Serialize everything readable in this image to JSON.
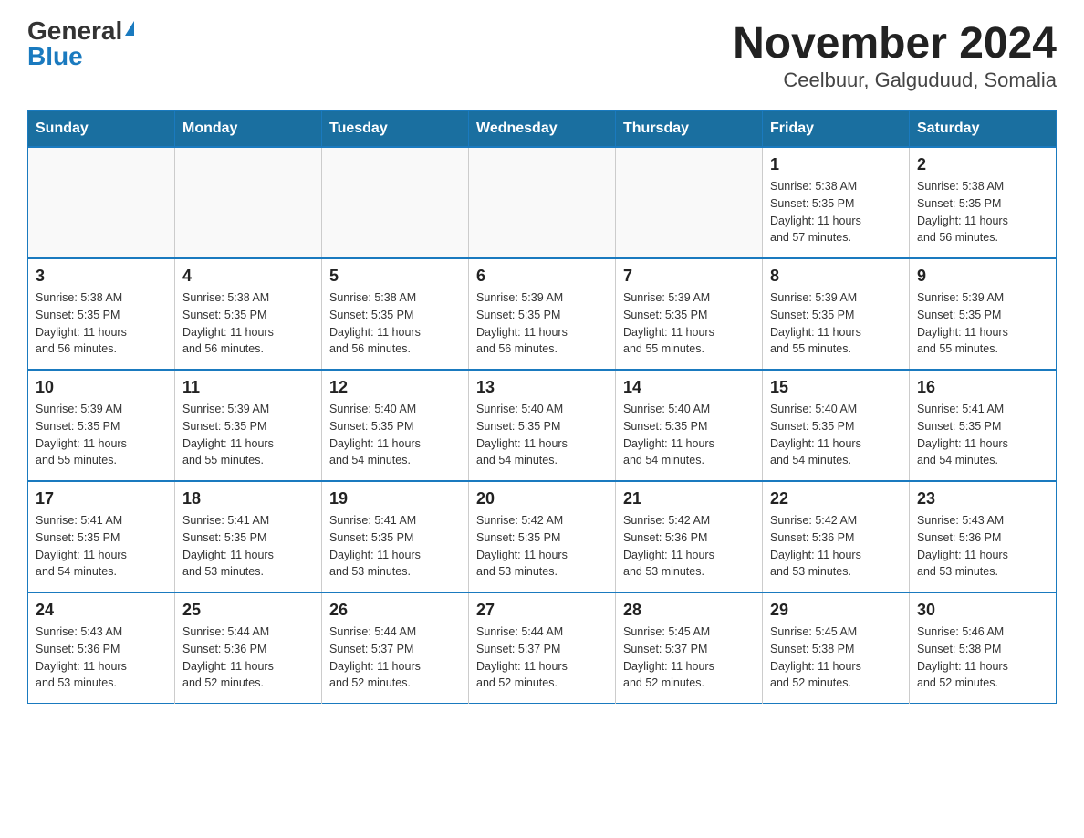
{
  "logo": {
    "general": "General",
    "blue": "Blue"
  },
  "title": "November 2024",
  "subtitle": "Ceelbuur, Galguduud, Somalia",
  "days_of_week": [
    "Sunday",
    "Monday",
    "Tuesday",
    "Wednesday",
    "Thursday",
    "Friday",
    "Saturday"
  ],
  "weeks": [
    [
      {
        "day": "",
        "info": ""
      },
      {
        "day": "",
        "info": ""
      },
      {
        "day": "",
        "info": ""
      },
      {
        "day": "",
        "info": ""
      },
      {
        "day": "",
        "info": ""
      },
      {
        "day": "1",
        "info": "Sunrise: 5:38 AM\nSunset: 5:35 PM\nDaylight: 11 hours\nand 57 minutes."
      },
      {
        "day": "2",
        "info": "Sunrise: 5:38 AM\nSunset: 5:35 PM\nDaylight: 11 hours\nand 56 minutes."
      }
    ],
    [
      {
        "day": "3",
        "info": "Sunrise: 5:38 AM\nSunset: 5:35 PM\nDaylight: 11 hours\nand 56 minutes."
      },
      {
        "day": "4",
        "info": "Sunrise: 5:38 AM\nSunset: 5:35 PM\nDaylight: 11 hours\nand 56 minutes."
      },
      {
        "day": "5",
        "info": "Sunrise: 5:38 AM\nSunset: 5:35 PM\nDaylight: 11 hours\nand 56 minutes."
      },
      {
        "day": "6",
        "info": "Sunrise: 5:39 AM\nSunset: 5:35 PM\nDaylight: 11 hours\nand 56 minutes."
      },
      {
        "day": "7",
        "info": "Sunrise: 5:39 AM\nSunset: 5:35 PM\nDaylight: 11 hours\nand 55 minutes."
      },
      {
        "day": "8",
        "info": "Sunrise: 5:39 AM\nSunset: 5:35 PM\nDaylight: 11 hours\nand 55 minutes."
      },
      {
        "day": "9",
        "info": "Sunrise: 5:39 AM\nSunset: 5:35 PM\nDaylight: 11 hours\nand 55 minutes."
      }
    ],
    [
      {
        "day": "10",
        "info": "Sunrise: 5:39 AM\nSunset: 5:35 PM\nDaylight: 11 hours\nand 55 minutes."
      },
      {
        "day": "11",
        "info": "Sunrise: 5:39 AM\nSunset: 5:35 PM\nDaylight: 11 hours\nand 55 minutes."
      },
      {
        "day": "12",
        "info": "Sunrise: 5:40 AM\nSunset: 5:35 PM\nDaylight: 11 hours\nand 54 minutes."
      },
      {
        "day": "13",
        "info": "Sunrise: 5:40 AM\nSunset: 5:35 PM\nDaylight: 11 hours\nand 54 minutes."
      },
      {
        "day": "14",
        "info": "Sunrise: 5:40 AM\nSunset: 5:35 PM\nDaylight: 11 hours\nand 54 minutes."
      },
      {
        "day": "15",
        "info": "Sunrise: 5:40 AM\nSunset: 5:35 PM\nDaylight: 11 hours\nand 54 minutes."
      },
      {
        "day": "16",
        "info": "Sunrise: 5:41 AM\nSunset: 5:35 PM\nDaylight: 11 hours\nand 54 minutes."
      }
    ],
    [
      {
        "day": "17",
        "info": "Sunrise: 5:41 AM\nSunset: 5:35 PM\nDaylight: 11 hours\nand 54 minutes."
      },
      {
        "day": "18",
        "info": "Sunrise: 5:41 AM\nSunset: 5:35 PM\nDaylight: 11 hours\nand 53 minutes."
      },
      {
        "day": "19",
        "info": "Sunrise: 5:41 AM\nSunset: 5:35 PM\nDaylight: 11 hours\nand 53 minutes."
      },
      {
        "day": "20",
        "info": "Sunrise: 5:42 AM\nSunset: 5:35 PM\nDaylight: 11 hours\nand 53 minutes."
      },
      {
        "day": "21",
        "info": "Sunrise: 5:42 AM\nSunset: 5:36 PM\nDaylight: 11 hours\nand 53 minutes."
      },
      {
        "day": "22",
        "info": "Sunrise: 5:42 AM\nSunset: 5:36 PM\nDaylight: 11 hours\nand 53 minutes."
      },
      {
        "day": "23",
        "info": "Sunrise: 5:43 AM\nSunset: 5:36 PM\nDaylight: 11 hours\nand 53 minutes."
      }
    ],
    [
      {
        "day": "24",
        "info": "Sunrise: 5:43 AM\nSunset: 5:36 PM\nDaylight: 11 hours\nand 53 minutes."
      },
      {
        "day": "25",
        "info": "Sunrise: 5:44 AM\nSunset: 5:36 PM\nDaylight: 11 hours\nand 52 minutes."
      },
      {
        "day": "26",
        "info": "Sunrise: 5:44 AM\nSunset: 5:37 PM\nDaylight: 11 hours\nand 52 minutes."
      },
      {
        "day": "27",
        "info": "Sunrise: 5:44 AM\nSunset: 5:37 PM\nDaylight: 11 hours\nand 52 minutes."
      },
      {
        "day": "28",
        "info": "Sunrise: 5:45 AM\nSunset: 5:37 PM\nDaylight: 11 hours\nand 52 minutes."
      },
      {
        "day": "29",
        "info": "Sunrise: 5:45 AM\nSunset: 5:38 PM\nDaylight: 11 hours\nand 52 minutes."
      },
      {
        "day": "30",
        "info": "Sunrise: 5:46 AM\nSunset: 5:38 PM\nDaylight: 11 hours\nand 52 minutes."
      }
    ]
  ]
}
